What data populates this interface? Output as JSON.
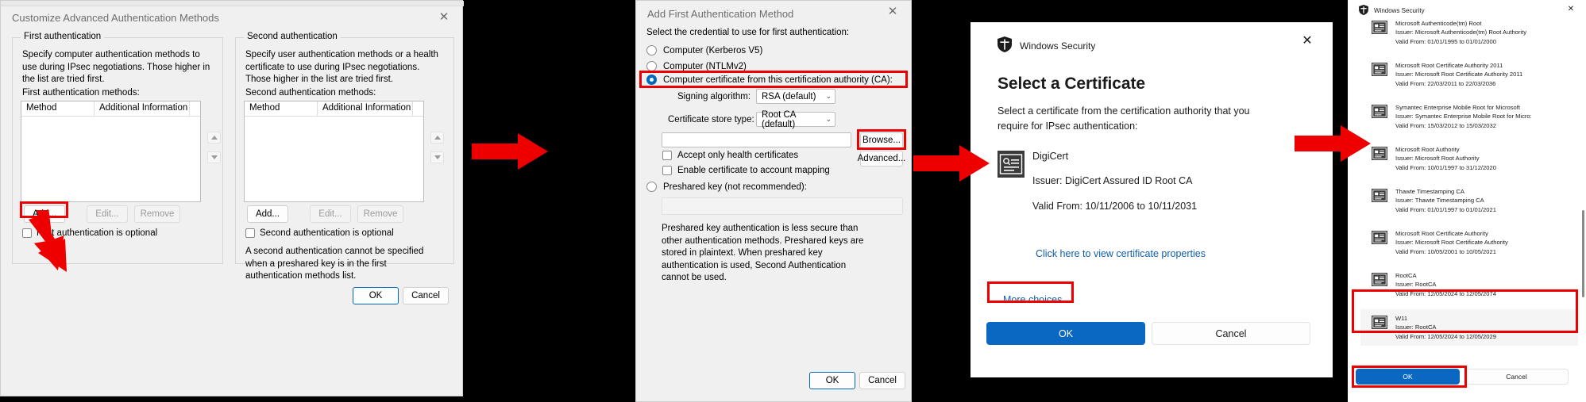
{
  "panel1": {
    "window_title": "Customize Advanced Authentication Methods",
    "close_icon": "close-icon",
    "first": {
      "group_label": "First authentication",
      "description": "Specify computer authentication methods to use during IPsec negotiations.  Those higher in the list are tried first.",
      "list_label": "First authentication methods:",
      "columns": [
        "Method",
        "Additional Information"
      ],
      "rows": [],
      "buttons": {
        "add": "Add...",
        "edit": "Edit...",
        "remove": "Remove"
      },
      "optional_checkbox": "First authentication is optional"
    },
    "second": {
      "group_label": "Second authentication",
      "description": "Specify user authentication methods or a health certificate to use during IPsec negotiations.  Those higher in the list are tried first.",
      "list_label": "Second authentication methods:",
      "columns": [
        "Method",
        "Additional Information"
      ],
      "rows": [],
      "buttons": {
        "add": "Add...",
        "edit": "Edit...",
        "remove": "Remove"
      },
      "optional_checkbox": "Second authentication is optional",
      "note": "A second authentication cannot be specified when a preshared key is in the first authentication methods list."
    },
    "footer": {
      "ok": "OK",
      "cancel": "Cancel"
    }
  },
  "panel2": {
    "window_title": "Add First Authentication Method",
    "close_icon": "close-icon",
    "prompt": "Select the credential to use for first authentication:",
    "options": [
      {
        "label": "Computer (Kerberos V5)",
        "selected": false
      },
      {
        "label": "Computer (NTLMv2)",
        "selected": false
      },
      {
        "label": "Computer certificate from this certification authority (CA):",
        "selected": true
      },
      {
        "label": "Preshared key (not recommended):",
        "selected": false
      }
    ],
    "signing_algorithm_label": "Signing algorithm:",
    "signing_algorithm_value": "RSA (default)",
    "cert_store_label": "Certificate store type:",
    "cert_store_value": "Root CA (default)",
    "ca_input_value": "",
    "browse_button": "Browse...",
    "advanced_button": "Advanced...",
    "checkboxes": [
      "Accept only health certificates",
      "Enable certificate to account mapping"
    ],
    "preshared_input_value": "",
    "preshared_note": "Preshared key authentication is less secure than other authentication methods. Preshared keys are stored in plaintext. When preshared key authentication is used, Second Authentication cannot be used.",
    "footer": {
      "ok": "OK",
      "cancel": "Cancel"
    }
  },
  "panel3": {
    "app_title": "Windows Security",
    "shield_icon": "shield-icon",
    "close_icon": "close-icon",
    "heading": "Select a Certificate",
    "body": "Select a certificate from the certification authority that you require for IPsec authentication:",
    "certificate": {
      "icon": "certificate-icon",
      "name": "DigiCert",
      "issuer": "Issuer: DigiCert Assured ID Root CA",
      "validity": "Valid From: 10/11/2006 to 10/11/2031"
    },
    "properties_link": "Click here to view certificate properties",
    "more_choices": "More choices",
    "footer": {
      "ok": "OK",
      "cancel": "Cancel"
    }
  },
  "panel4": {
    "app_title": "Windows Security",
    "shield_icon": "shield-icon",
    "close_icon": "close-icon",
    "certificates": [
      {
        "name": "Microsoft Authenticode(tm) Root",
        "issuer": "Issuer: Microsoft Authenticode(tm) Root Authority",
        "validity": "Valid From: 01/01/1995 to 01/01/2000",
        "selected": false
      },
      {
        "name": "Microsoft Root Certificate Authority 2011",
        "issuer": "Issuer: Microsoft Root Certificate Authority 2011",
        "validity": "Valid From: 22/03/2011 to 22/03/2036",
        "selected": false
      },
      {
        "name": "Symantec Enterprise Mobile Root for Microsoft",
        "issuer": "Issuer: Symantec Enterprise Mobile Root for Micro:",
        "validity": "Valid From: 15/03/2012 to 15/03/2032",
        "selected": false
      },
      {
        "name": "Microsoft Root Authority",
        "issuer": "Issuer: Microsoft Root Authority",
        "validity": "Valid From: 10/01/1997 to 31/12/2020",
        "selected": false
      },
      {
        "name": "Thawte Timestamping CA",
        "issuer": "Issuer: Thawte Timestamping CA",
        "validity": "Valid From: 01/01/1997 to 01/01/2021",
        "selected": false
      },
      {
        "name": "Microsoft Root Certificate Authority",
        "issuer": "Issuer: Microsoft Root Certificate Authority",
        "validity": "Valid From: 10/05/2001 to 10/05/2021",
        "selected": false
      },
      {
        "name": "RootCA",
        "issuer": "Issuer: RootCA",
        "validity": "Valid From: 12/05/2024 to 12/05/2074",
        "selected": false
      },
      {
        "name": "W11",
        "issuer": "Issuer: RootCA",
        "validity": "Valid From: 12/05/2024 to 12/05/2029",
        "selected": true
      }
    ],
    "footer": {
      "ok": "OK",
      "cancel": "Cancel"
    }
  },
  "annotations": {
    "highlight_color": "#ee0000",
    "arrow_color": "#ee0000",
    "arrow_count": 4,
    "highlighted": [
      "panel1-add-button",
      "panel2-computer-certificate-radio",
      "panel2-browse-button",
      "panel3-more-choices-link",
      "panel4-certificate-w11",
      "panel4-ok-button"
    ]
  }
}
